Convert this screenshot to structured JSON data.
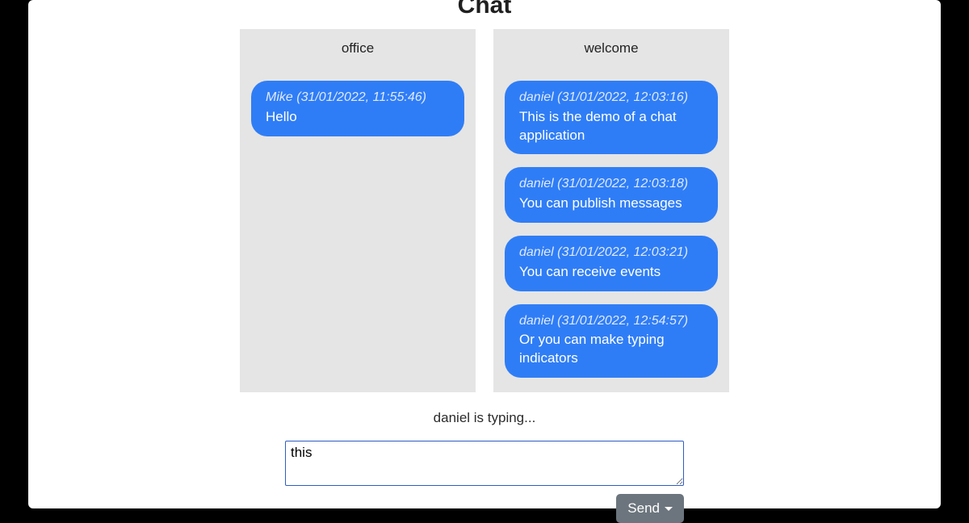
{
  "page_title": "Chat",
  "rooms": [
    {
      "name": "office",
      "messages": [
        {
          "author": "Mike",
          "timestamp": "31/01/2022, 11:55:46",
          "body": "Hello"
        }
      ]
    },
    {
      "name": "welcome",
      "messages": [
        {
          "author": "daniel",
          "timestamp": "31/01/2022, 12:03:16",
          "body": "This is the demo of a chat application"
        },
        {
          "author": "daniel",
          "timestamp": "31/01/2022, 12:03:18",
          "body": "You can publish messages"
        },
        {
          "author": "daniel",
          "timestamp": "31/01/2022, 12:03:21",
          "body": "You can receive events"
        },
        {
          "author": "daniel",
          "timestamp": "31/01/2022, 12:54:57",
          "body": "Or you can make typing indicators"
        }
      ]
    }
  ],
  "typing_indicator": "daniel is typing...",
  "composer": {
    "value": "this",
    "send_label": "Send"
  },
  "colors": {
    "bubble": "#2f7df6",
    "room_bg": "#e5e5e5",
    "send_btn": "#6c757d",
    "textarea_border": "#2f5cc4"
  }
}
